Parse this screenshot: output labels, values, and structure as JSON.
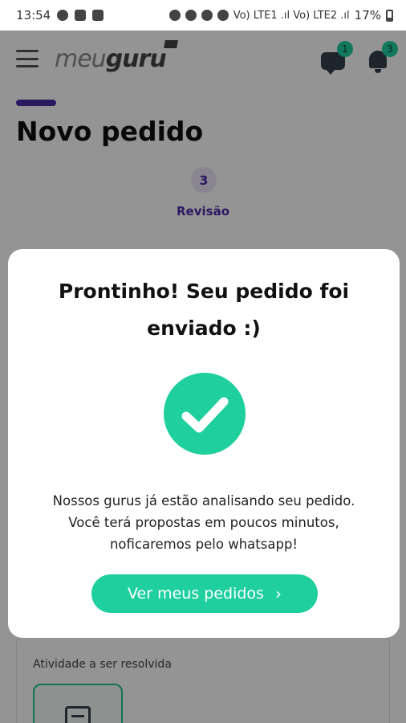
{
  "status_bar": {
    "time": "13:54",
    "signal_text": "Vo) LTE1 .ıl Vo) LTE2 .ıl",
    "battery": "17%"
  },
  "header": {
    "logo_light": "meu",
    "logo_bold": "guru",
    "messages_badge": "1",
    "notifications_badge": "3"
  },
  "page": {
    "title": "Novo pedido",
    "step_number": "3",
    "step_label": "Revisão",
    "activity_label": "Atividade a ser resolvida"
  },
  "modal": {
    "title": "Prontinho! Seu pedido foi enviado :)",
    "message_line1": "Nossos gurus já estão analisando seu pedido.",
    "message_line2": "Você terá propostas em poucos minutos,",
    "message_line3": "noficaremos pelo whatsapp!",
    "button_label": "Ver meus pedidos",
    "button_chevron": "›"
  },
  "colors": {
    "accent_green": "#1fcf9e",
    "accent_purple": "#4b2aa8"
  }
}
